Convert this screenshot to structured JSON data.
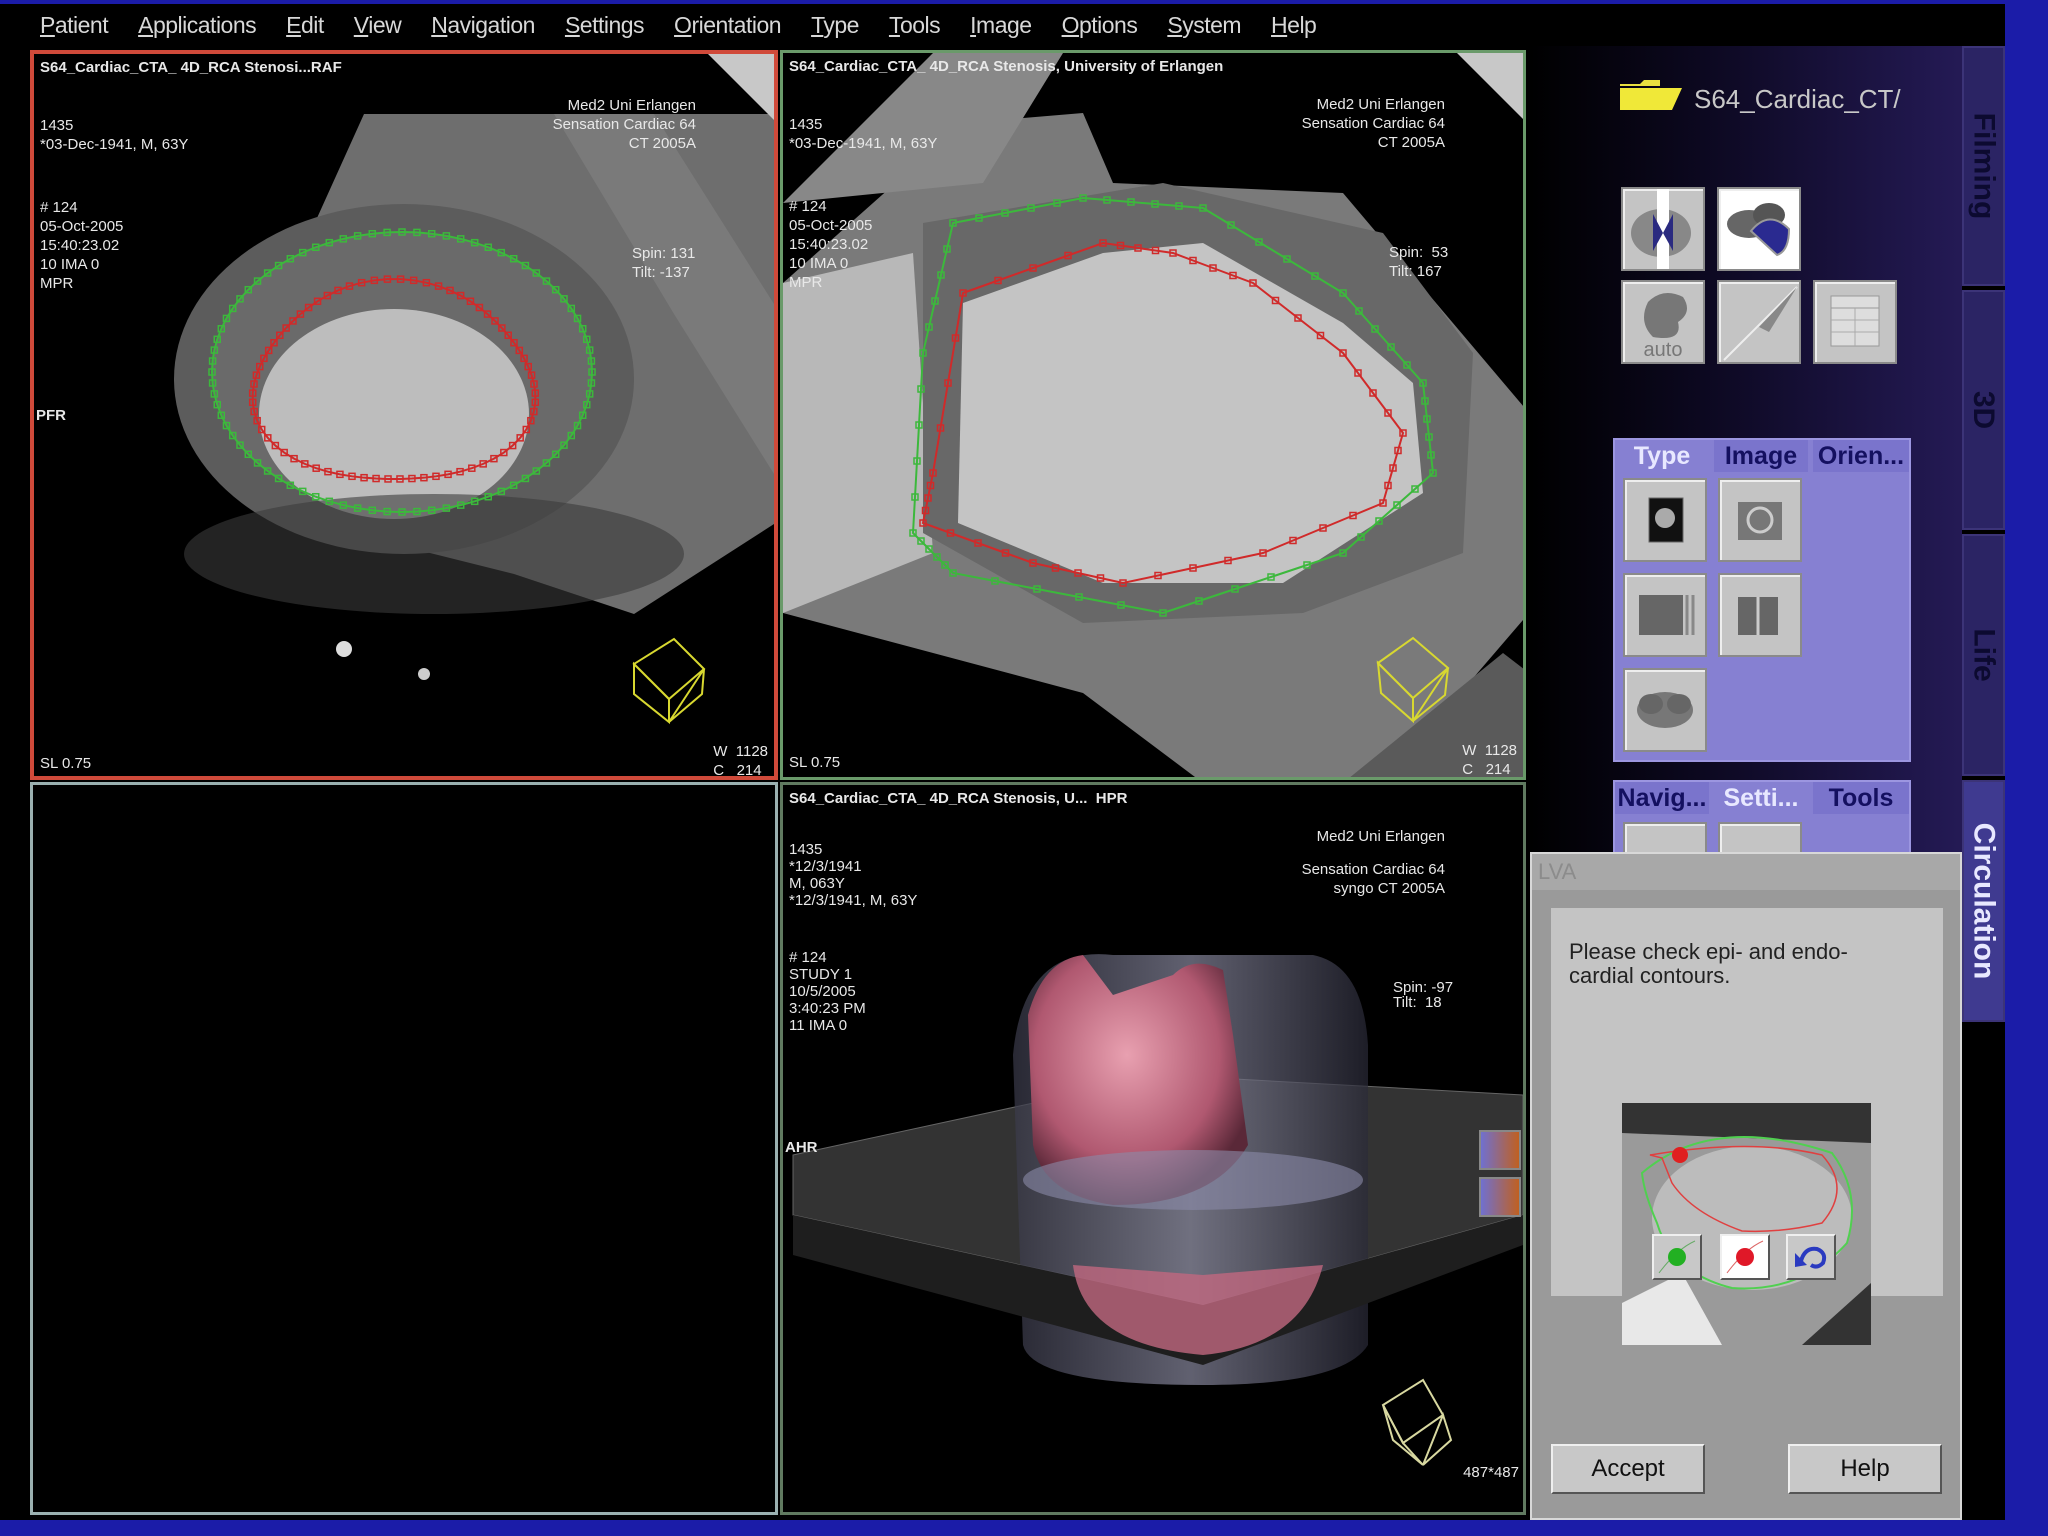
{
  "menu": [
    "Patient",
    "Applications",
    "Edit",
    "View",
    "Navigation",
    "Settings",
    "Orientation",
    "Type",
    "Tools",
    "Image",
    "Options",
    "System",
    "Help"
  ],
  "viewports": {
    "top_left": {
      "title": "S64_Cardiac_CTA_ 4D_RCA Stenosi...RAF",
      "left_info": [
        "1435",
        "*03-Dec-1941, M, 63Y",
        "# 124",
        "05-Oct-2005",
        "15:40:23.02",
        "10 IMA 0",
        "MPR"
      ],
      "right_info": [
        "Med2 Uni Erlangen",
        "Sensation Cardiac 64",
        "CT 2005A"
      ],
      "spin": "Spin: 131",
      "tilt": "Tilt: -137",
      "orientation": "PFR",
      "slice": "SL 0.75",
      "window": "W  1128",
      "center": "C   214"
    },
    "top_right": {
      "title": "S64_Cardiac_CTA_ 4D_RCA Stenosis, University of Erlangen",
      "left_info": [
        "1435",
        "*03-Dec-1941, M, 63Y",
        "# 124",
        "05-Oct-2005",
        "15:40:23.02",
        "10 IMA 0",
        "MPR"
      ],
      "right_info": [
        "Med2 Uni Erlangen",
        "Sensation Cardiac 64",
        "CT 2005A"
      ],
      "spin": "Spin:  53",
      "tilt": "Tilt: 167",
      "slice": "SL 0.75",
      "window": "W  1128",
      "center": "C   214"
    },
    "bottom_right": {
      "title": "S64_Cardiac_CTA_ 4D_RCA Stenosis, U...  HPR",
      "left_info": [
        "1435",
        "*12/3/1941",
        "M, 063Y",
        "*12/3/1941, M, 63Y"
      ],
      "left_info2": [
        "# 124",
        "STUDY 1",
        "10/5/2005",
        "3:40:23 PM",
        "11 IMA 0"
      ],
      "right_info": [
        "Med2 Uni Erlangen"
      ],
      "right_info2": [
        "Sensation Cardiac 64",
        "syngo CT 2005A"
      ],
      "spin": "Spin: -97",
      "tilt": "Tilt:  18",
      "orientation": "AHR",
      "matrix": "487*487"
    }
  },
  "right_panel": {
    "folder_name": "S64_Cardiac_CT/",
    "auto_label": "auto",
    "tabs1": [
      "Type",
      "Image",
      "Orien..."
    ],
    "tabs2": [
      "Navig...",
      "Setti...",
      "Tools"
    ],
    "side_tabs": [
      "Filming",
      "3D",
      "Life",
      "Circulation"
    ]
  },
  "dialog": {
    "title": "LVA",
    "message": "Please check epi- and endo-\ncardial contours.",
    "accept": "Accept",
    "help": "Help"
  },
  "colors": {
    "epi_contour": "#3cb83c",
    "endo_contour": "#d02a2a",
    "active_viewport": "#d04a3a",
    "panel_tab": "#8680d2"
  }
}
